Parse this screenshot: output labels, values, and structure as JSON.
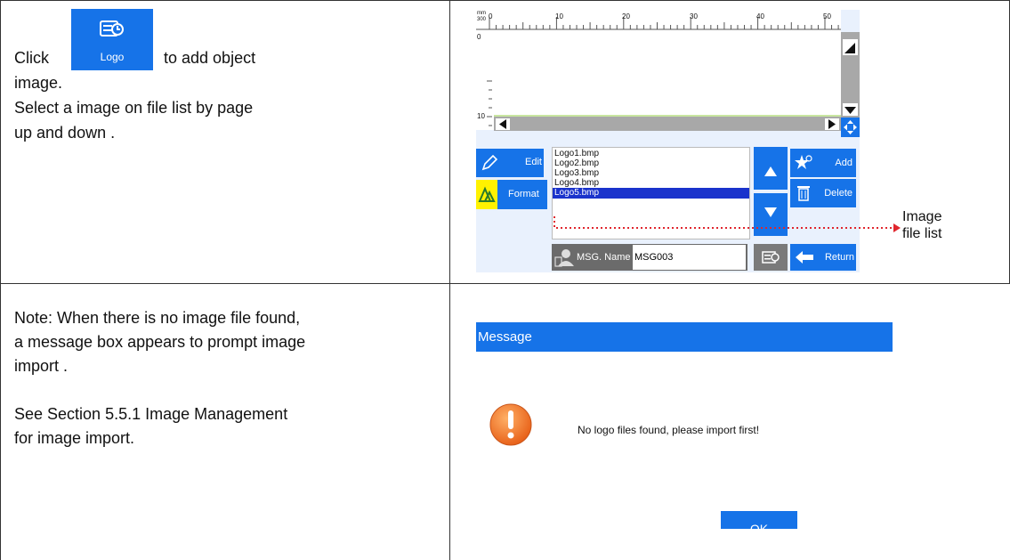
{
  "row1": {
    "line1_prefix": "Click",
    "line1_suffix": "to add object",
    "line2": "image.",
    "line3": "Select a image on file list by page",
    "line4": "up and down .",
    "logo_button_label": "Logo"
  },
  "editor": {
    "ruler_unit_top": "mm",
    "ruler_unit_bottom": "300",
    "ruler_labels": [
      "0",
      "10",
      "20",
      "30",
      "40",
      "50"
    ],
    "vruler_labels": [
      "0",
      "10"
    ],
    "edit_label": "Edit",
    "format_label": "Format",
    "add_label": "Add",
    "delete_label": "Delete",
    "return_label": "Return",
    "msg_name_label": "MSG. Name",
    "msg_name_value": "MSG003",
    "files": [
      "Logo1.bmp",
      "Logo2.bmp",
      "Logo3.bmp",
      "Logo4.bmp",
      "Logo5.bmp"
    ],
    "selected_file": "Logo5.bmp"
  },
  "callout": {
    "line1": "Image",
    "line2": "file list",
    "color": "#e0262e"
  },
  "row2": {
    "line1": "Note: When there is no image file found,",
    "line2": "a message box appears to prompt image",
    "line3": "import .",
    "line4": "See Section 5.5.1 Image Management",
    "line5": "for image import."
  },
  "dialog": {
    "title": "Message",
    "text": "No logo files found, please import first!",
    "ok_label": "OK"
  },
  "colors": {
    "accent_blue": "#1673e8",
    "selection": "#1a33cc"
  }
}
